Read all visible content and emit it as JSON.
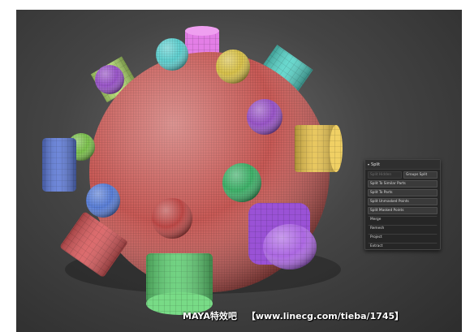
{
  "colors": {
    "background": "#3e3e3e",
    "sphere": "#c95a56",
    "panel": "#262626"
  },
  "split_panel": {
    "title": "Split",
    "buttons": {
      "split_hidden": "Split Hidden",
      "groups_split": "Groups Split",
      "split_similar": "Split To Similar Parts",
      "split_parts": "Split To Parts",
      "split_unmasked": "Split Unmasked Points",
      "split_masked": "Split Masked Points",
      "merge": "Merge",
      "remesh": "Remesh",
      "project": "Project",
      "extract": "Extract"
    }
  },
  "watermark": {
    "brand": "MAYA特效吧",
    "url": "【www.linecg.com/tieba/1745】"
  }
}
